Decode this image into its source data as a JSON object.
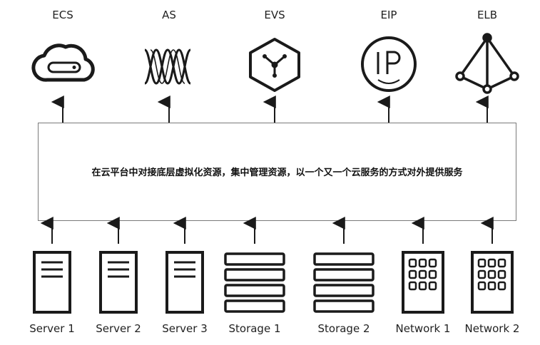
{
  "services": [
    {
      "id": "ecs",
      "label": "ECS",
      "icon": "cloud-server-icon"
    },
    {
      "id": "as",
      "label": "AS",
      "icon": "helix-icon"
    },
    {
      "id": "evs",
      "label": "EVS",
      "icon": "hexagon-node-icon"
    },
    {
      "id": "eip",
      "label": "EIP",
      "icon": "ip-circle-icon"
    },
    {
      "id": "elb",
      "label": "ELB",
      "icon": "balancer-triangle-icon"
    }
  ],
  "platform": {
    "description": "在云平台中对接底层虚拟化资源，集中管理资源，以一个又一个云服务的方式对外提供服务"
  },
  "resources": [
    {
      "label": "Server 1",
      "icon": "server-icon"
    },
    {
      "label": "Server 2",
      "icon": "server-icon"
    },
    {
      "label": "Server 3",
      "icon": "server-icon"
    },
    {
      "label": "Storage 1",
      "icon": "storage-icon"
    },
    {
      "label": "Storage 2",
      "icon": "storage-icon"
    },
    {
      "label": "Network 1",
      "icon": "network-icon"
    },
    {
      "label": "Network 2",
      "icon": "network-icon"
    }
  ],
  "colors": {
    "stroke": "#1a1a1a",
    "box_border": "#7a7a7a",
    "background": "#ffffff"
  }
}
